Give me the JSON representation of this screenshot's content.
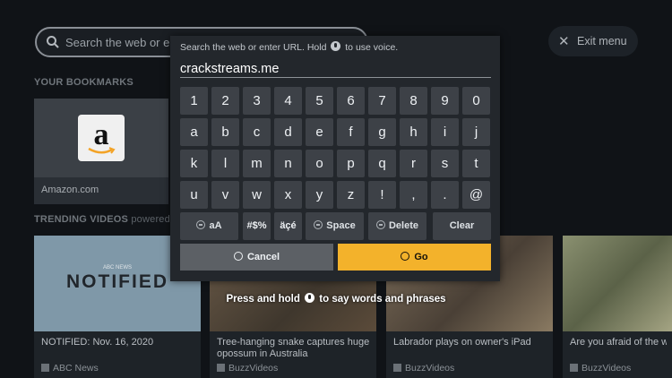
{
  "background": {
    "search_placeholder": "Search the web or en",
    "exit_label": "Exit menu",
    "bookmarks_title": "YOUR BOOKMARKS",
    "bookmark": {
      "label": "Amazon.com",
      "logo_letter": "a"
    },
    "trending_title": "TRENDING VIDEOS",
    "trending_sub": "powered b",
    "videos": [
      {
        "title": "NOTIFIED: Nov. 16, 2020",
        "source": "ABC News",
        "thumb_text": "NOTIFIED",
        "thumb_tag": "ABC NEWS"
      },
      {
        "title": "Tree-hanging snake captures huge opossum in Australia",
        "source": "BuzzVideos"
      },
      {
        "title": "Labrador plays on owner's iPad",
        "source": "BuzzVideos"
      },
      {
        "title": "Are you afraid of the w dangerous animals?",
        "source": "BuzzVideos"
      }
    ]
  },
  "keyboard": {
    "hint_before": "Search the web or enter URL. Hold",
    "hint_after": "to use voice.",
    "url_value": "crackstreams.me",
    "rows": [
      [
        "1",
        "2",
        "3",
        "4",
        "5",
        "6",
        "7",
        "8",
        "9",
        "0"
      ],
      [
        "a",
        "b",
        "c",
        "d",
        "e",
        "f",
        "g",
        "h",
        "i",
        "j"
      ],
      [
        "k",
        "l",
        "m",
        "n",
        "o",
        "p",
        "q",
        "r",
        "s",
        "t"
      ],
      [
        "u",
        "v",
        "w",
        "x",
        "y",
        "z",
        "!",
        ",",
        ".",
        "@"
      ]
    ],
    "function_keys": {
      "case": "aA",
      "symbols": "#$%",
      "accents": "äçé",
      "space": "Space",
      "delete": "Delete",
      "clear": "Clear"
    },
    "cancel_label": "Cancel",
    "go_label": "Go",
    "accent_color": "#f3b22b"
  },
  "press_hint": {
    "before": "Press and hold",
    "after": "to say words and phrases"
  }
}
